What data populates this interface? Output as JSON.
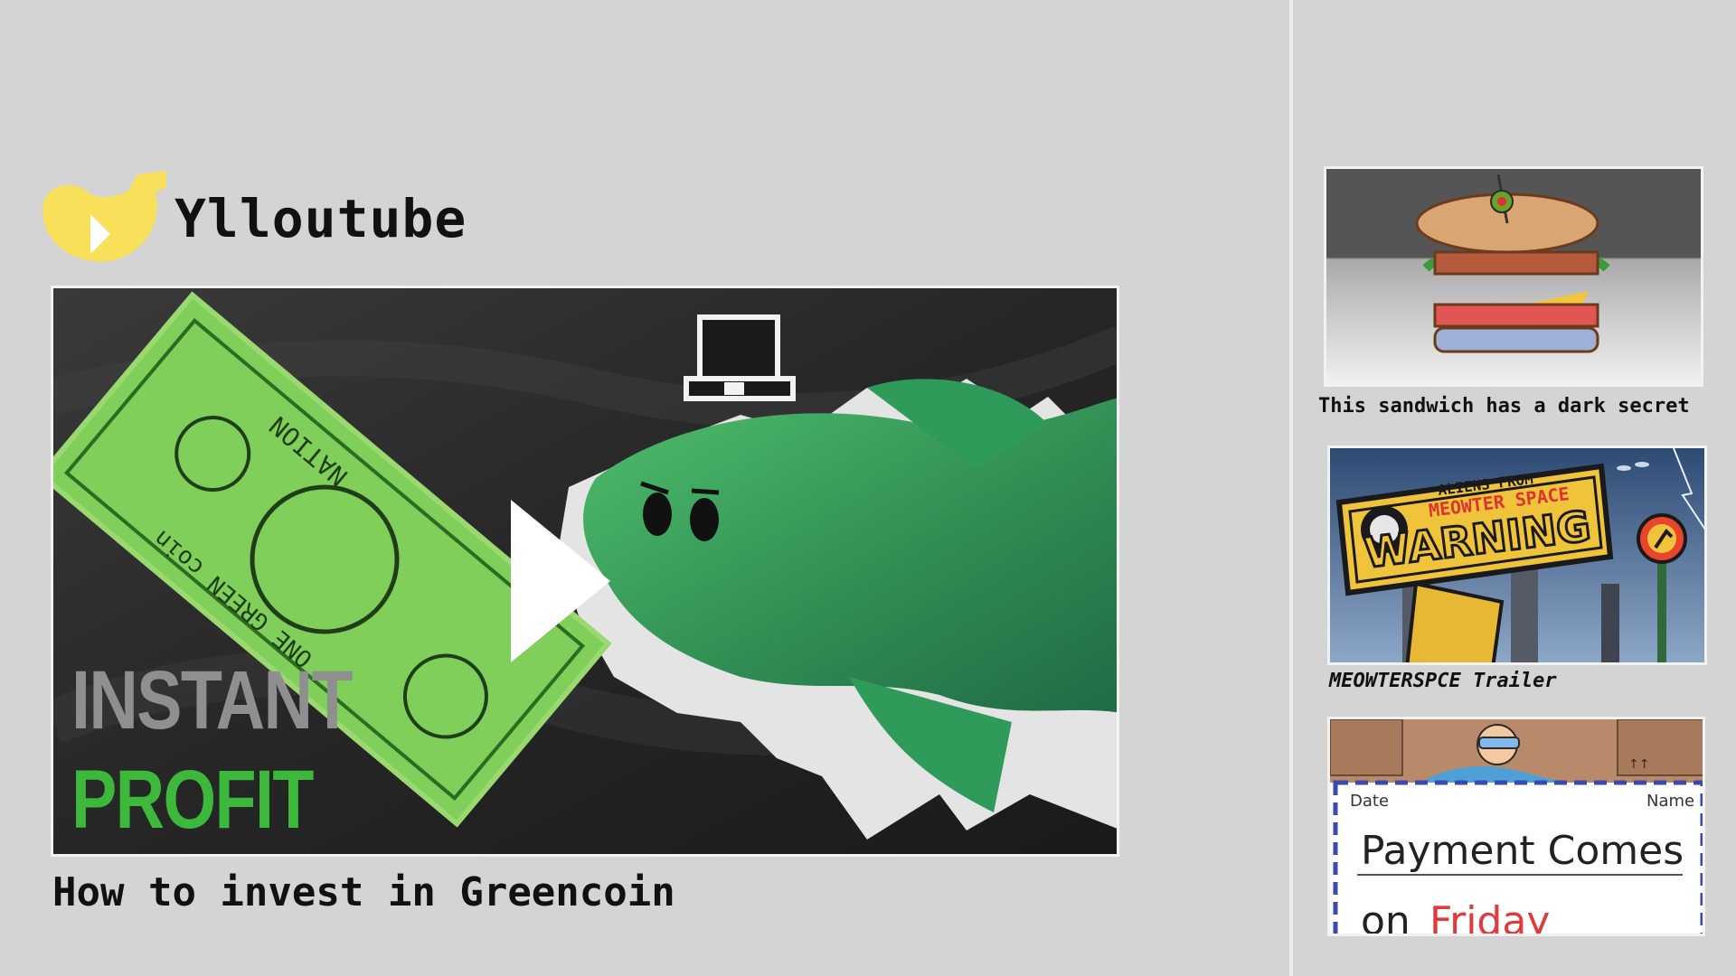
{
  "app": {
    "brand_name": "Ylloutube",
    "accent_color": "#f8e05a"
  },
  "main_video": {
    "title": "How to invest in Greencoin",
    "thumbnail_text_line1": "INSTANT",
    "thumbnail_text_line2": "PROFIT",
    "banknote_text_nation": "NATION",
    "banknote_text_coin": "ONE GREEN coin",
    "play_icon": "play-icon"
  },
  "sidebar": {
    "videos": [
      {
        "title": "This sandwich has a dark secret"
      },
      {
        "title": "MEOWTERSPCE Trailer",
        "sign_small": "ALIENS FROM",
        "sign_main": "MEOWTER SPACE",
        "sign_warning": "WARNING"
      },
      {
        "title": "",
        "label_date": "Date",
        "label_name": "Name",
        "line1": "Payment Comes",
        "line2_a": "on",
        "line2_b": "Friday"
      }
    ]
  }
}
